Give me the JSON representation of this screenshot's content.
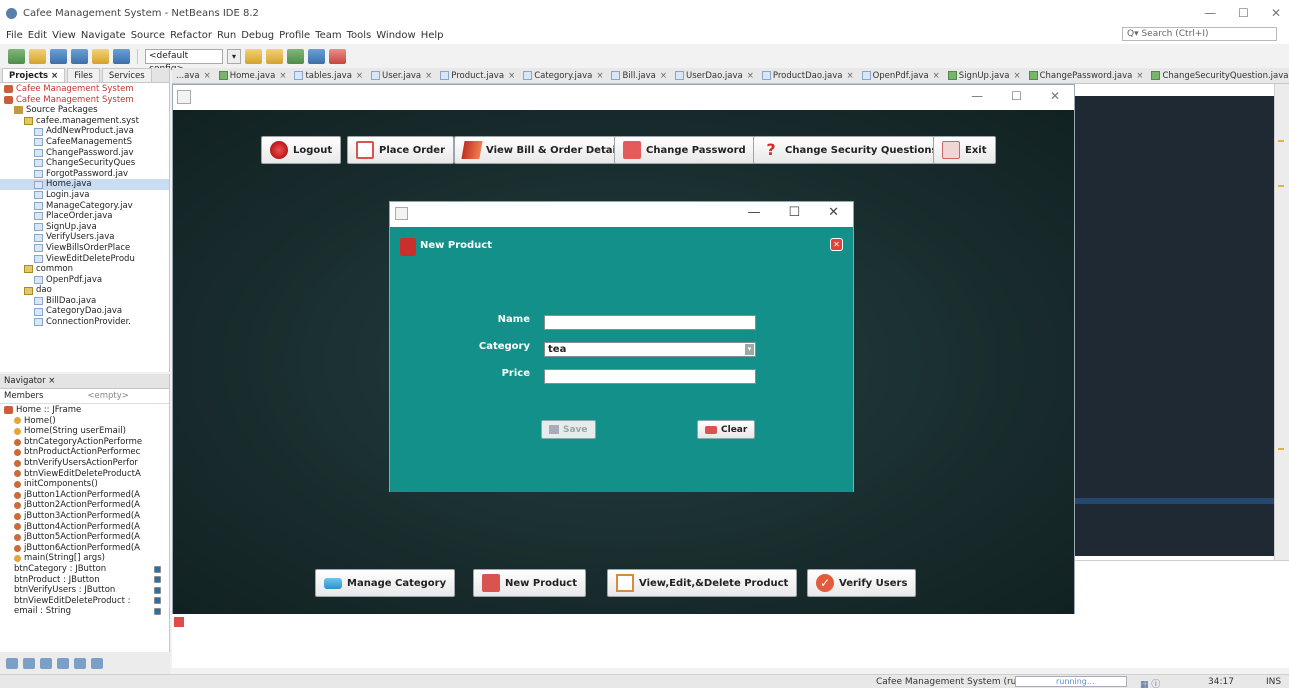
{
  "window": {
    "title": "Cafee Management System - NetBeans IDE 8.2"
  },
  "menu": [
    "File",
    "Edit",
    "View",
    "Navigate",
    "Source",
    "Refactor",
    "Run",
    "Debug",
    "Profile",
    "Team",
    "Tools",
    "Window",
    "Help"
  ],
  "search": {
    "placeholder": "Search (Ctrl+I)"
  },
  "toolbar": {
    "config": "<default config>"
  },
  "project_panel": {
    "tabs": [
      "Projects ×",
      "Files",
      "Services"
    ],
    "tree": [
      {
        "label": "Cafee Management System",
        "type": "proj",
        "indent": 0,
        "red": true
      },
      {
        "label": "Cafee Management System",
        "type": "proj",
        "indent": 0,
        "red": true
      },
      {
        "label": "Source Packages",
        "type": "src",
        "indent": 1
      },
      {
        "label": "cafee.management.syst",
        "type": "pkg",
        "indent": 2
      },
      {
        "label": "AddNewProduct.java",
        "type": "file",
        "indent": 3
      },
      {
        "label": "CafeeManagementS",
        "type": "file",
        "indent": 3
      },
      {
        "label": "ChangePassword.jav",
        "type": "file",
        "indent": 3
      },
      {
        "label": "ChangeSecurityQues",
        "type": "file",
        "indent": 3
      },
      {
        "label": "ForgotPassword.jav",
        "type": "file",
        "indent": 3
      },
      {
        "label": "Home.java",
        "type": "file",
        "indent": 3,
        "selected": true
      },
      {
        "label": "Login.java",
        "type": "file",
        "indent": 3
      },
      {
        "label": "ManageCategory.jav",
        "type": "file",
        "indent": 3
      },
      {
        "label": "PlaceOrder.java",
        "type": "file",
        "indent": 3
      },
      {
        "label": "SignUp.java",
        "type": "file",
        "indent": 3
      },
      {
        "label": "VerifyUsers.java",
        "type": "file",
        "indent": 3
      },
      {
        "label": "ViewBillsOrderPlace",
        "type": "file",
        "indent": 3
      },
      {
        "label": "ViewEditDeleteProdu",
        "type": "file",
        "indent": 3
      },
      {
        "label": "common",
        "type": "pkg",
        "indent": 2
      },
      {
        "label": "OpenPdf.java",
        "type": "file",
        "indent": 3
      },
      {
        "label": "dao",
        "type": "pkg",
        "indent": 2
      },
      {
        "label": "BillDao.java",
        "type": "file",
        "indent": 3
      },
      {
        "label": "CategoryDao.java",
        "type": "file",
        "indent": 3
      },
      {
        "label": "ConnectionProvider.",
        "type": "file",
        "indent": 3
      }
    ]
  },
  "navigator": {
    "title": "Navigator ×",
    "members_label": "Members",
    "filter": "<empty>",
    "items": [
      {
        "label": "Home :: JFrame",
        "type": "proj"
      },
      {
        "label": "Home()",
        "type": "meth"
      },
      {
        "label": "Home(String userEmail)",
        "type": "meth"
      },
      {
        "label": "btnCategoryActionPerforme",
        "type": "meth2"
      },
      {
        "label": "btnProductActionPerformec",
        "type": "meth2"
      },
      {
        "label": "btnVerifyUsersActionPerfor",
        "type": "meth2"
      },
      {
        "label": "btnViewEditDeleteProductA",
        "type": "meth2"
      },
      {
        "label": "initComponents()",
        "type": "meth2"
      },
      {
        "label": "jButton1ActionPerformed(A",
        "type": "meth2"
      },
      {
        "label": "jButton2ActionPerformed(A",
        "type": "meth2"
      },
      {
        "label": "jButton3ActionPerformed(A",
        "type": "meth2"
      },
      {
        "label": "jButton4ActionPerformed(A",
        "type": "meth2"
      },
      {
        "label": "jButton5ActionPerformed(A",
        "type": "meth2"
      },
      {
        "label": "jButton6ActionPerformed(A",
        "type": "meth2"
      },
      {
        "label": "main(String[] args)",
        "type": "meth"
      },
      {
        "label": "btnCategory : JButton",
        "type": "field"
      },
      {
        "label": "btnProduct : JButton",
        "type": "field"
      },
      {
        "label": "btnVerifyUsers : JButton",
        "type": "field"
      },
      {
        "label": "btnViewEditDeleteProduct :",
        "type": "field"
      },
      {
        "label": "email : String",
        "type": "field"
      }
    ]
  },
  "editor_tabs": [
    {
      "label": "...ava",
      "form": false
    },
    {
      "label": "Home.java",
      "form": true
    },
    {
      "label": "tables.java",
      "form": false
    },
    {
      "label": "User.java",
      "form": false
    },
    {
      "label": "Product.java",
      "form": false
    },
    {
      "label": "Category.java",
      "form": false
    },
    {
      "label": "Bill.java",
      "form": false
    },
    {
      "label": "UserDao.java",
      "form": false
    },
    {
      "label": "ProductDao.java",
      "form": false
    },
    {
      "label": "OpenPdf.java",
      "form": false
    },
    {
      "label": "SignUp.java",
      "form": true
    },
    {
      "label": "ChangePassword.java",
      "form": true
    },
    {
      "label": "ChangeSecurityQuestion.java...",
      "form": true
    }
  ],
  "home": {
    "top_buttons": [
      {
        "label": "Logout",
        "icon": "logout"
      },
      {
        "label": "Place Order",
        "icon": "order"
      },
      {
        "label": "View Bill & Order Details",
        "icon": "bill"
      },
      {
        "label": "Change Password",
        "icon": "pass"
      },
      {
        "label": "Change Security Questions",
        "icon": "question",
        "glyph": "?"
      },
      {
        "label": "Exit",
        "icon": "exit"
      }
    ],
    "bottom_buttons": [
      {
        "label": "Manage Category",
        "icon": "cat"
      },
      {
        "label": "New Product",
        "icon": "newp"
      },
      {
        "label": "View,Edit,&Delete Product",
        "icon": "view"
      },
      {
        "label": "Verify Users",
        "icon": "verify",
        "glyph": "✓"
      }
    ]
  },
  "dialog": {
    "title": "New Product",
    "fields": {
      "name_label": "Name",
      "name_value": "",
      "category_label": "Category",
      "category_value": "tea",
      "price_label": "Price",
      "price_value": ""
    },
    "save_label": "Save",
    "clear_label": "Clear"
  },
  "status": {
    "run_name": "Cafee Management System (run)",
    "progress_text": "running...",
    "position": "34:17",
    "mode": "INS"
  }
}
